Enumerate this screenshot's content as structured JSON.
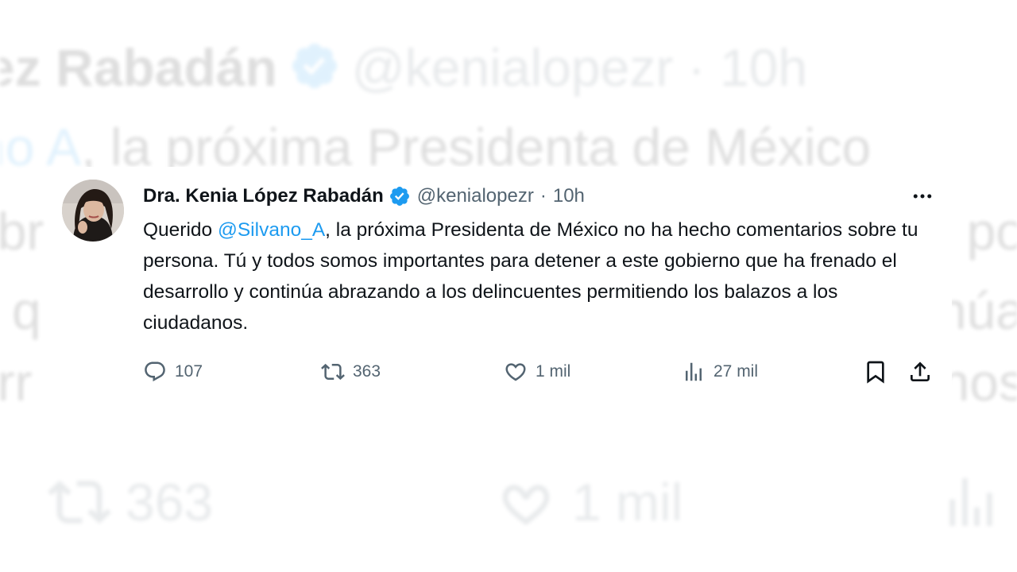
{
  "author": {
    "name": "Dra. Kenia López Rabadán",
    "handle": "@kenialopezr",
    "separator": "·",
    "time": "10h"
  },
  "tweet": {
    "prefix": "Querido ",
    "mention": "@Silvano_A",
    "body": ", la próxima Presidenta de México no ha hecho comentarios sobre tu persona. Tú y todos somos importantes para detener a este gobierno que ha frenado el desarrollo y continúa abrazando a los delincuentes permitiendo los balazos a los ciudadanos."
  },
  "metrics": {
    "replies": "107",
    "reposts": "363",
    "likes": "1 mil",
    "views": "27 mil"
  },
  "background": {
    "name_fragment": "ez Rabadán",
    "handle_fragment": "@kenialopezr · 10h",
    "mention_fragment": "no A",
    "text_fragment": ", la próxima Presidenta de México",
    "left_line_2": "obr",
    "left_line_3": "o q",
    "left_line_4": "err",
    "right_line_2": "po",
    "right_line_3": "núa",
    "right_line_4": "nos",
    "reposts": "363",
    "likes": "1 mil"
  },
  "colors": {
    "accent": "#1d9bf0",
    "text": "#0f1419",
    "secondary": "#536471"
  },
  "icons": [
    "verified-badge-icon",
    "more-options-icon",
    "reply-icon",
    "repost-icon",
    "like-icon",
    "views-icon",
    "bookmark-icon",
    "share-icon"
  ]
}
